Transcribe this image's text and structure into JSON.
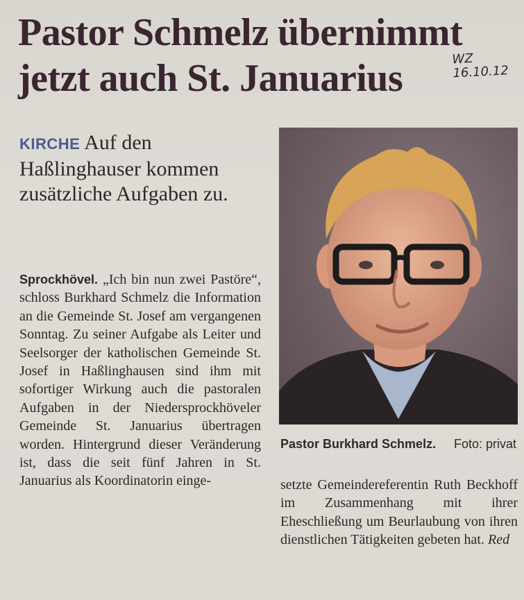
{
  "article": {
    "headline_line1": "Pastor Schmelz übernimmt",
    "headline_line2": "jetzt auch St. Januarius",
    "handwritten_note": {
      "line1": "WZ",
      "line2": "16.10.12"
    },
    "kicker": "KIRCHE",
    "subhead": "Auf den Haßlinghauser kommen zusätzliche Aufgaben zu.",
    "dateline": "Sprockhövel.",
    "body_left": "„Ich bin nun zwei Pastöre“, schloss Burkhard Schmelz die Information an die Gemeinde St. Josef am vergangenen Sonntag. Zu seiner Aufgabe als Leiter und Seelsorger der katholischen Gemeinde St. Josef in Haßlinghausen sind ihm mit sofortiger Wirkung auch die pastoralen Aufgaben in der Niedersprockhöveler Gemeinde St. Januarius übertragen worden. Hintergrund dieser Veränderung ist, dass die seit fünf Jahren in St. Januarius als Koordinatorin einge-",
    "body_right": "setzte Gemeindereferentin Ruth Beckhoff im Zusammenhang mit ihrer Eheschließung um Beurlaubung von ihren dienstlichen Tätigkeiten gebeten hat.",
    "author": "Red",
    "caption_name": "Pastor Burkhard Schmelz.",
    "caption_credit": "Foto: privat"
  },
  "colors": {
    "headline": "#3a2530",
    "kicker": "#4a5b93",
    "paper": "#dcdad3"
  }
}
